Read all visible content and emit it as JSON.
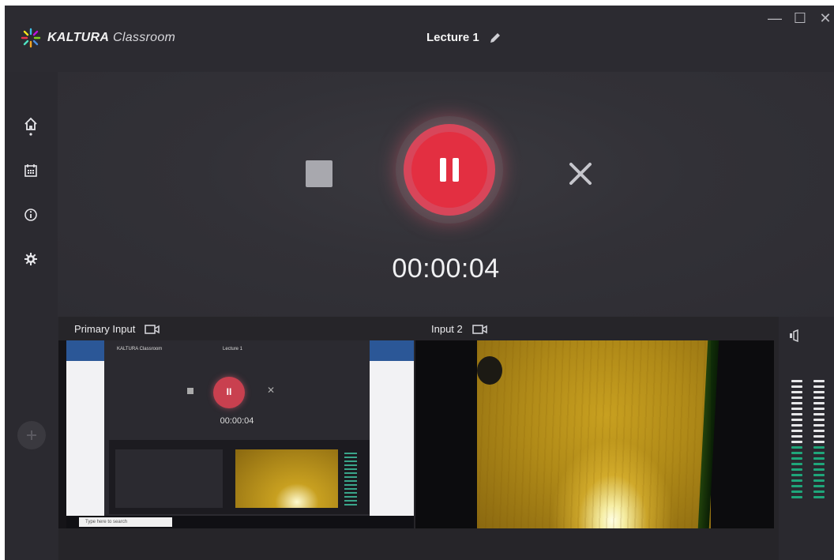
{
  "app": {
    "brand_bold": "KALTURA",
    "brand_light": "Classroom",
    "lecture_title": "Lecture 1",
    "window_controls": [
      "—",
      "☐",
      "✕"
    ]
  },
  "nav": {
    "items": [
      {
        "name": "home",
        "icon": "home-icon"
      },
      {
        "name": "schedule",
        "icon": "calendar-icon"
      },
      {
        "name": "info",
        "icon": "info-icon"
      },
      {
        "name": "settings",
        "icon": "gear-icon"
      }
    ]
  },
  "recording": {
    "timer": "00:00:04",
    "state": "recording",
    "accent_color": "#e32f41"
  },
  "inputs": {
    "primary_label": "Primary Input",
    "second_label": "Input 2"
  },
  "nested_preview": {
    "title": "KALTURA Classroom",
    "lecture": "Lecture 1",
    "timer": "00:00:04",
    "search_placeholder": "Type here to search"
  },
  "audio": {
    "meter_total_segments": 22,
    "meter_active_segments": 10,
    "active_color": "#1fa67a",
    "inactive_color": "#e6e6e8"
  }
}
